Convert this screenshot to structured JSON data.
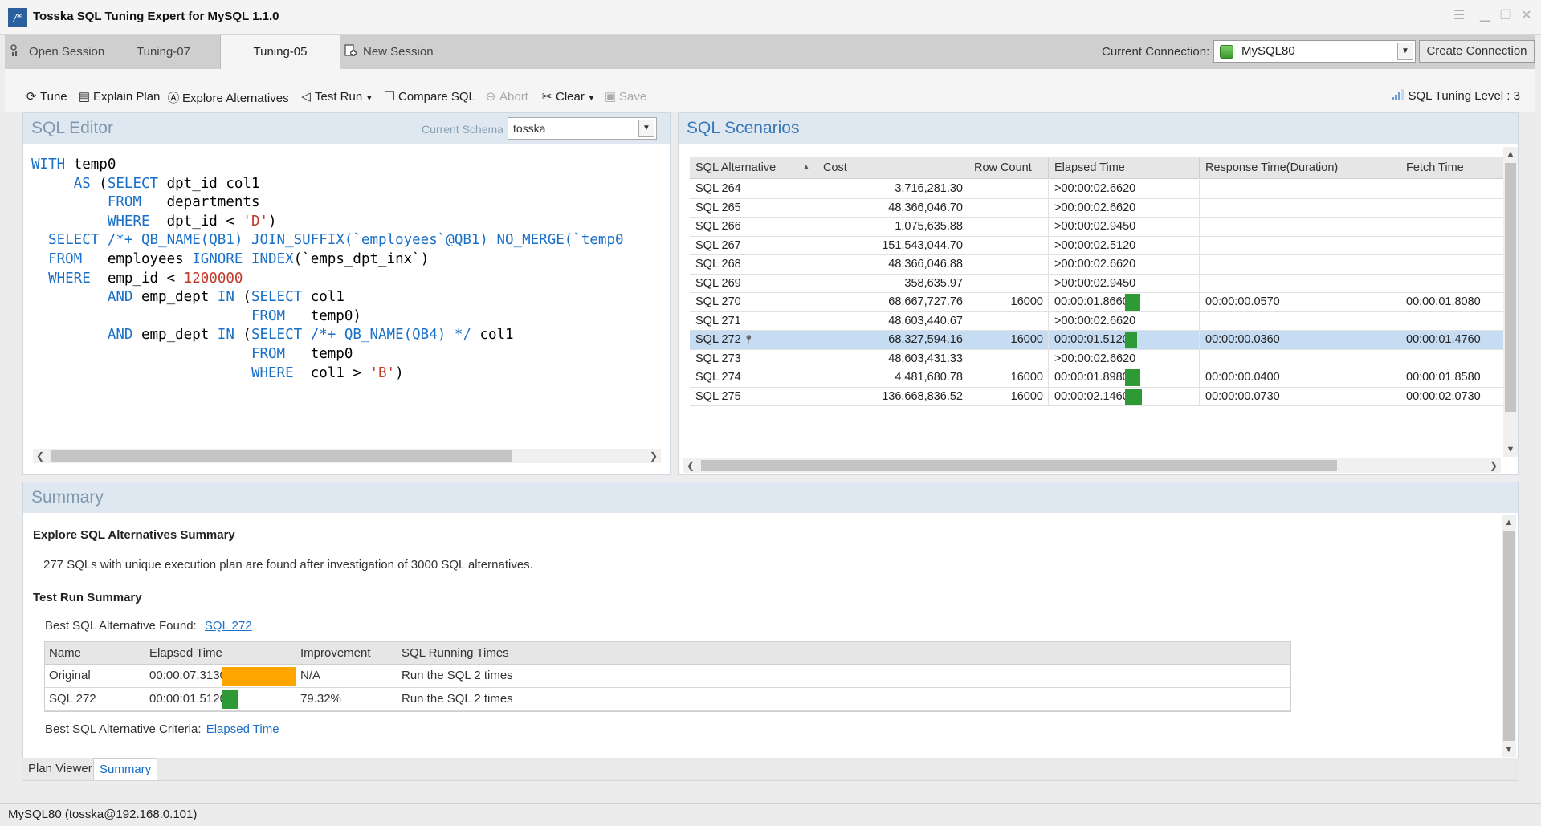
{
  "window": {
    "title": "Tosska SQL Tuning Expert for MySQL 1.1.0"
  },
  "tabs": [
    {
      "label": "Open Session",
      "icon": "open-session-icon"
    },
    {
      "label": "Tuning-07"
    },
    {
      "label": "Tuning-05",
      "active": true
    },
    {
      "label": "New Session",
      "icon": "new-session-icon"
    }
  ],
  "connection": {
    "label": "Current Connection:",
    "value": "MySQL80",
    "create_label": "Create Connection"
  },
  "toolbar": {
    "tune": "Tune",
    "explain_plan": "Explain Plan",
    "explore_alternatives": "Explore Alternatives",
    "test_run": "Test Run",
    "compare_sql": "Compare SQL",
    "abort": "Abort",
    "clear": "Clear",
    "save": "Save",
    "tuning_level": "SQL Tuning Level : 3"
  },
  "sql_editor": {
    "title": "SQL Editor",
    "schema_label": "Current Schema",
    "schema_value": "tosska",
    "lines": [
      "WITH temp0",
      "     AS (SELECT dpt_id col1",
      "         FROM   departments",
      "         WHERE  dpt_id < 'D')",
      "  SELECT /*+ QB_NAME(QB1) JOIN_SUFFIX(`employees`@QB1) NO_MERGE(`temp0",
      "  FROM   employees IGNORE INDEX(`emps_dpt_inx`)",
      "  WHERE  emp_id < 1200000",
      "         AND emp_dept IN (SELECT col1",
      "                          FROM   temp0)",
      "         AND emp_dept IN (SELECT /*+ QB_NAME(QB4) */ col1",
      "                          FROM   temp0",
      "                          WHERE  col1 > 'B')"
    ]
  },
  "scenarios": {
    "title": "SQL Scenarios",
    "columns": [
      "SQL Alternative",
      "Cost",
      "Row Count",
      "Elapsed Time",
      "Response Time(Duration)",
      "Fetch Time"
    ],
    "rows": [
      {
        "name": "SQL 264",
        "cost": "3,716,281.30",
        "rows": "",
        "elapsed": ">00:00:02.6620",
        "response": "",
        "fetch": "",
        "bar": 0
      },
      {
        "name": "SQL 265",
        "cost": "48,366,046.70",
        "rows": "",
        "elapsed": ">00:00:02.6620",
        "response": "",
        "fetch": "",
        "bar": 0
      },
      {
        "name": "SQL 266",
        "cost": "1,075,635.88",
        "rows": "",
        "elapsed": ">00:00:02.9450",
        "response": "",
        "fetch": "",
        "bar": 0
      },
      {
        "name": "SQL 267",
        "cost": "151,543,044.70",
        "rows": "",
        "elapsed": ">00:00:02.5120",
        "response": "",
        "fetch": "",
        "bar": 0
      },
      {
        "name": "SQL 268",
        "cost": "48,366,046.88",
        "rows": "",
        "elapsed": ">00:00:02.6620",
        "response": "",
        "fetch": "",
        "bar": 0
      },
      {
        "name": "SQL 269",
        "cost": "358,635.97",
        "rows": "",
        "elapsed": ">00:00:02.9450",
        "response": "",
        "fetch": "",
        "bar": 0
      },
      {
        "name": "SQL 270",
        "cost": "68,667,727.76",
        "rows": "16000",
        "elapsed": "00:00:01.8660",
        "response": "00:00:00.0570",
        "fetch": "00:00:01.8080",
        "bar": 1.866
      },
      {
        "name": "SQL 271",
        "cost": "48,603,440.67",
        "rows": "",
        "elapsed": ">00:00:02.6620",
        "response": "",
        "fetch": "",
        "bar": 0
      },
      {
        "name": "SQL 272",
        "cost": "68,327,594.16",
        "rows": "16000",
        "elapsed": "00:00:01.5120",
        "response": "00:00:00.0360",
        "fetch": "00:00:01.4760",
        "bar": 1.512,
        "selected": true
      },
      {
        "name": "SQL 273",
        "cost": "48,603,431.33",
        "rows": "",
        "elapsed": ">00:00:02.6620",
        "response": "",
        "fetch": "",
        "bar": 0
      },
      {
        "name": "SQL 274",
        "cost": "4,481,680.78",
        "rows": "16000",
        "elapsed": "00:00:01.8980",
        "response": "00:00:00.0400",
        "fetch": "00:00:01.8580",
        "bar": 1.898
      },
      {
        "name": "SQL 275",
        "cost": "136,668,836.52",
        "rows": "16000",
        "elapsed": "00:00:02.1460",
        "response": "00:00:00.0730",
        "fetch": "00:00:02.0730",
        "bar": 2.146
      }
    ]
  },
  "summary": {
    "title": "Summary",
    "explore_heading": "Explore SQL Alternatives Summary",
    "explore_text": "277 SQLs with unique execution plan are found after investigation of 3000 SQL alternatives.",
    "test_heading": "Test Run Summary",
    "best_found_label": "Best SQL Alternative Found:",
    "best_found_link": "SQL 272",
    "columns": [
      "Name",
      "Elapsed Time",
      "Improvement",
      "SQL Running Times"
    ],
    "rows": [
      {
        "name": "Original",
        "elapsed": "00:00:07.3130",
        "improvement": "N/A",
        "running": "Run the SQL 2  times",
        "bar": 7.313,
        "color": "#ffa500"
      },
      {
        "name": "SQL 272",
        "elapsed": "00:00:01.5120",
        "improvement": "79.32%",
        "running": "Run the SQL 2  times",
        "bar": 1.512,
        "color": "#2e9a36"
      }
    ],
    "criteria_label": "Best SQL Alternative Criteria:",
    "criteria_link": "Elapsed Time"
  },
  "bottom_tabs": [
    "Plan Viewer",
    "Summary"
  ],
  "status": {
    "text": "MySQL80 (tosska@192.168.0.101)"
  },
  "colors": {
    "accent": "#1a6fc8",
    "selection": "#c5dcf2",
    "bar_green": "#2e9a36",
    "bar_orange": "#ffa500"
  }
}
